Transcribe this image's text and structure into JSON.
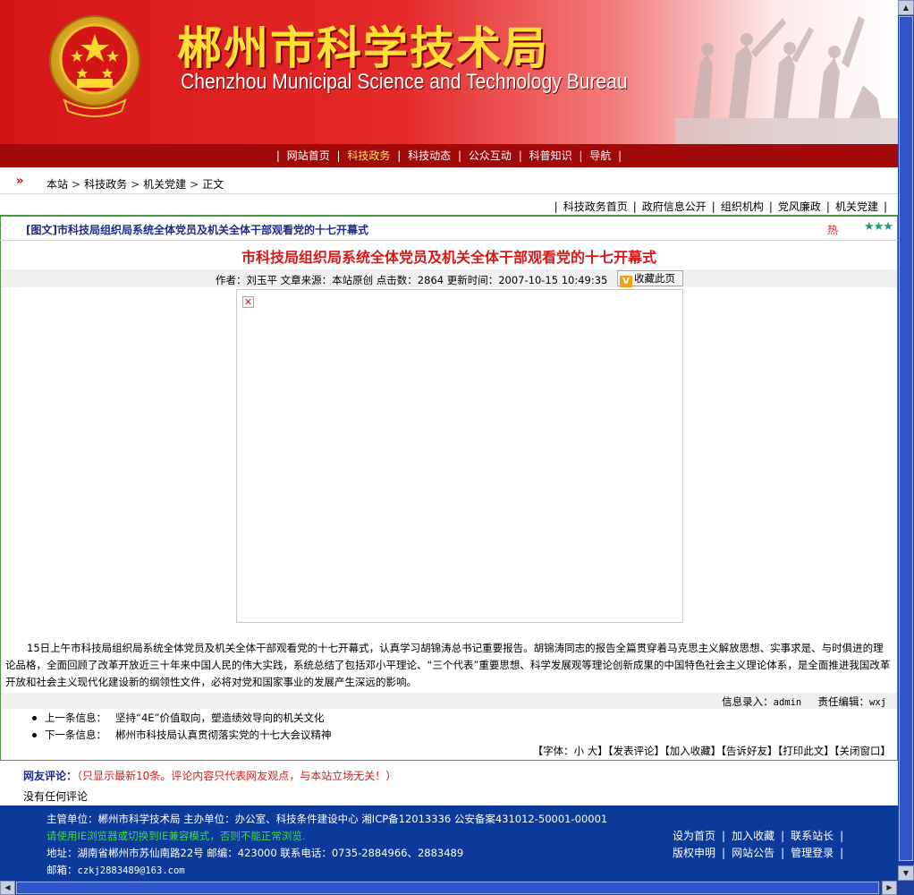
{
  "banner": {
    "title_cn": "郴州市科学技术局",
    "title_en": "Chenzhou Municipal  Science and Technology Bureau"
  },
  "main_nav": {
    "items": [
      {
        "label": "网站首页",
        "active": false
      },
      {
        "label": "科技政务",
        "active": true
      },
      {
        "label": "科技动态",
        "active": false
      },
      {
        "label": "公众互动",
        "active": false
      },
      {
        "label": "科普知识",
        "active": false
      },
      {
        "label": "导航",
        "active": false
      }
    ]
  },
  "breadcrumb": {
    "arrow": "»",
    "items": [
      "本站",
      "科技政务",
      "机关党建",
      "正文"
    ]
  },
  "sub_nav": {
    "items": [
      "科技政务首页",
      "政府信息公开",
      "组织机构",
      "党风廉政",
      "机关党建"
    ]
  },
  "article": {
    "list_title": "[图文]市科技局组织局系统全体党员及机关全体干部观看党的十七开幕式",
    "hot_label": "热",
    "stars": "★★★",
    "headline": "市科技局组织局系统全体党员及机关全体干部观看党的十七开幕式",
    "meta": "作者：刘玉平 文章来源：本站原创 点击数：2864 更新时间：2007-10-15 10:49:35",
    "favorite_button": "收藏此页",
    "favorite_icon": "V",
    "broken_image_icon": "✕",
    "body": "15日上午市科技局组织局系统全体党员及机关全体干部观看党的十七开幕式，认真学习胡锦涛总书记重要报告。胡锦涛同志的报告全篇贯穿着马克思主义解放思想、实事求是、与时俱进的理论品格，全面回顾了改革开放近三十年来中国人民的伟大实践，系统总结了包括邓小平理论、“三个代表”重要思想、科学发展观等理论创新成果的中国特色社会主义理论体系，是全面推进我国改革开放和社会主义现代化建设新的纲领性文件，必将对党和国家事业的发展产生深远的影响。",
    "recorder_label": "信息录入：",
    "recorder_value": "admin",
    "editor_label": "责任编辑：",
    "editor_value": "wxj",
    "prev_label": "上一条信息：",
    "prev_title": "坚持“4E”价值取向，塑造绩效导向的机关文化",
    "next_label": "下一条信息：",
    "next_title": "郴州市科技局认真贯彻落实党的十七大会议精神",
    "tools": [
      "【字体：",
      "小",
      "大",
      "】",
      "【发表评论】",
      "【加入收藏】",
      "【告诉好友】",
      "【打印此文】",
      "【关闭窗口】"
    ]
  },
  "comments": {
    "label": "网友评论：",
    "note": "（只显示最新10条。评论内容只代表网友观点，与本站立场无关！）",
    "empty": "没有任何评论"
  },
  "footer": {
    "line1": "主管单位：郴州市科学技术局 主办单位：办公室、科技条件建设中心 湘ICP备12013336 公安备案431012-50001-00001",
    "line2": "请使用IE浏览器或切换到IE兼容模式，否则不能正常浏览.",
    "line3": "地址：湖南省郴州市苏仙南路22号 邮编：423000 联系电话：0735-2884966、2883489",
    "line4_label": "邮箱：",
    "line4_value": "czkj2883489@163.com",
    "links_row1": [
      "设为首页",
      "加入收藏",
      "联系站长"
    ],
    "links_row2": [
      "版权申明",
      "网站公告",
      "管理登录"
    ]
  },
  "colors": {
    "banner_red": "#d51616",
    "nav_bg": "#a20a0a",
    "nav_active": "#ffe066",
    "headline_red": "#d81818",
    "frame_green": "#4a9a40",
    "footer_blue": "#0b3a9a",
    "footer_notice_green": "#3fdc3f",
    "scrollbar_blue": "#1e3f9c"
  }
}
